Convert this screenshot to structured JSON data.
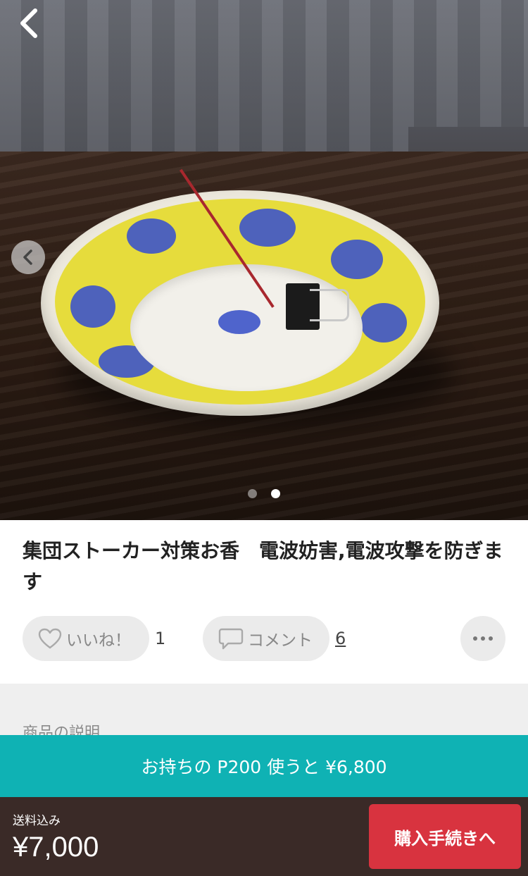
{
  "product": {
    "title": "集団ストーカー対策お香　電波妨害,電波攻撃を防ぎます",
    "image_indicator": {
      "total": 2,
      "active": 2
    }
  },
  "actions": {
    "like_label": "いいね！",
    "like_count": "1",
    "comment_label": "コメント",
    "comment_count": "6"
  },
  "description": {
    "section_label": "商品の説明"
  },
  "points": {
    "text": "お持ちの P200 使うと ¥6,800"
  },
  "checkout": {
    "shipping_label": "送料込み",
    "price": "¥7,000",
    "buy_label": "購入手続きへ"
  },
  "colors": {
    "points_bar": "#0fb2b4",
    "buy_button": "#d8333f",
    "bottom_bar": "#3a2a27"
  },
  "icons": [
    "back-icon",
    "chevron-left-icon",
    "heart-icon",
    "comment-bubble-icon",
    "more-icon"
  ]
}
